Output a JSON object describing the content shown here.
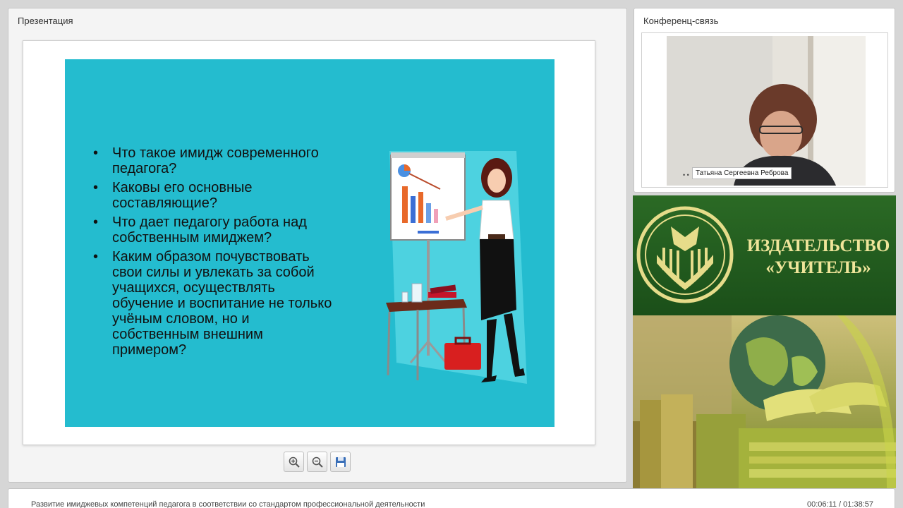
{
  "presentation": {
    "title": "Презентация",
    "slide": {
      "bullets": [
        "Что такое имидж современного педагога?",
        "Каковы его основные составляющие?",
        "Что дает педагогу работа над собственным имиджем?",
        "Каким образом почувствовать свои силы и увлекать за собой учащихся, осуществлять обучение и воспитание не только учёным словом, но и собственным внешним примером?"
      ]
    },
    "toolbar": {
      "zoom_in_icon": "zoom-in-icon",
      "zoom_out_icon": "zoom-out-icon",
      "save_icon": "floppy-disk-icon"
    }
  },
  "conference": {
    "title": "Конференц-связь",
    "speaker_name": "Татьяна Сергеевна Реброва"
  },
  "banner": {
    "publisher_line1": "ИЗДАТЕЛЬСТВО",
    "publisher_line2": "«УЧИТЕЛЬ»"
  },
  "footer": {
    "lecture_title": "Развитие имиджевых компетенций педагога в соответствии со стандартом профессиональной деятельности",
    "current_time": "00:06:11",
    "total_time": "01:38:57",
    "time_separator": " / "
  },
  "colors": {
    "slide_background": "#24bccf",
    "banner_green": "#1f5a1c",
    "banner_gold": "#efe59a"
  }
}
